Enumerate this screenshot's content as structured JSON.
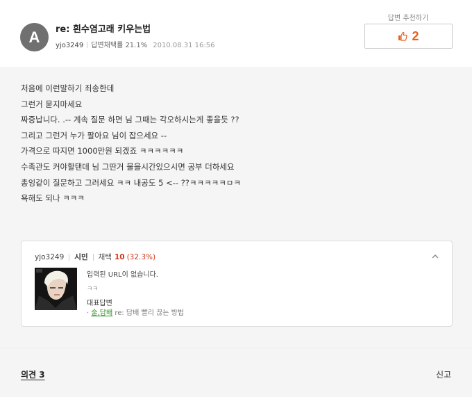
{
  "question": {
    "avatar_letter": "A",
    "title": "re: 흰수염고래 키우는법",
    "user_id": "yjo3249",
    "answer_rate": "답변채택률 21.1%",
    "date": "2010.08.31 16:56"
  },
  "recommend": {
    "label": "답변 추천하기",
    "count": "2",
    "icon": "thumbs-up-icon"
  },
  "body_lines": [
    "처음에 이런말하기 죄송한데",
    "그런거 묻지마세요",
    "짜증납니다. .-- 계속 질문 하면 님 그때는 각오하시는게 좋을듯 ??",
    "그리고 그런거 누가 팔아요 님이 잡으세요 --",
    "가격으로 따지면 1000만원 되겠죠 ㅋㅋㅋㅋㅋㅋ",
    "수족관도 커야할탠데 님 그딴거 물을시간있으시면 공부 더하세요",
    "총잉같이 질문하고 그러세요 ㅋㅋ 내공도 5 <-- ??ㅋㅋㅋㅋㅋㅁㅋ",
    "욕해도 되나 ㅋㅋㅋ"
  ],
  "profile": {
    "user_id": "yjo3249",
    "rank": "시민",
    "adopt_label": "채택",
    "adopt_count": "10",
    "adopt_pct": "(32.3%)",
    "intro": "입력된 URL이 없습니다.",
    "sub": "ㅋㅋ",
    "rep_label": "대표답변",
    "rep_bullet": "·",
    "rep_category": "술,담배",
    "rep_title": "re: 담배 빨리 끊는 방법"
  },
  "footer": {
    "opinions": "의견 3",
    "report": "신고"
  },
  "colors": {
    "accent_orange": "#e8601c",
    "count_red": "#d23a1c",
    "category_green": "#2c8a1e"
  }
}
